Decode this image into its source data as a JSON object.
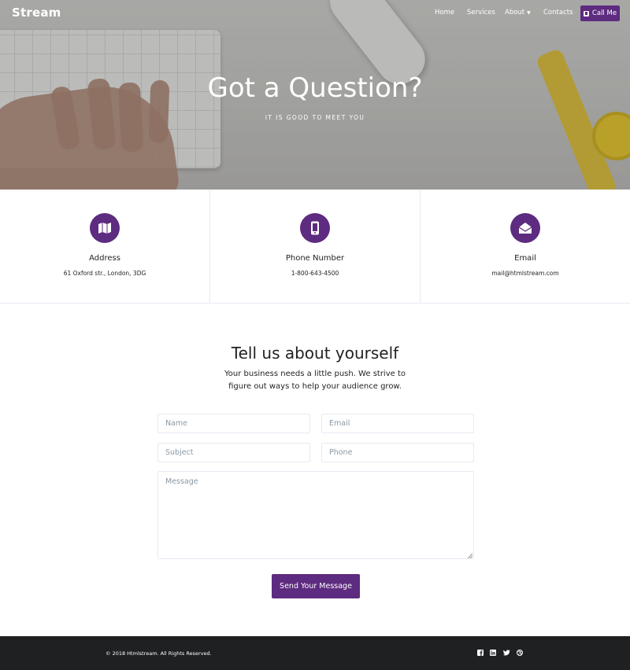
{
  "navbar": {
    "brand": "Stream",
    "links": [
      "Home",
      "Services",
      "About",
      "Contacts"
    ],
    "cta_label": "Call Me"
  },
  "hero": {
    "title": "Got a Question?",
    "subtitle": "IT IS GOOD TO MEET YOU"
  },
  "contacts": [
    {
      "icon": "map-icon",
      "title": "Address",
      "value": "61 Oxford str., London, 3DG"
    },
    {
      "icon": "mobile-icon",
      "title": "Phone Number",
      "value": "1-800-643-4500"
    },
    {
      "icon": "envelope-icon",
      "title": "Email",
      "value": "mail@htmlstream.com"
    }
  ],
  "form": {
    "title": "Tell us about yourself",
    "description": "Your business needs a little push. We strive to figure out ways to help your audience grow.",
    "name_placeholder": "Name",
    "email_placeholder": "Email",
    "subject_placeholder": "Subject",
    "phone_placeholder": "Phone",
    "message_placeholder": "Message",
    "submit_label": "Send Your Message"
  },
  "footer": {
    "copyright": "© 2018 Htmlstream. All Rights Reserved.",
    "social": [
      "facebook-icon",
      "linkedin-icon",
      "twitter-icon",
      "dribbble-icon"
    ]
  },
  "colors": {
    "accent": "#5d2b7f",
    "footer_bg": "#1e2022"
  }
}
